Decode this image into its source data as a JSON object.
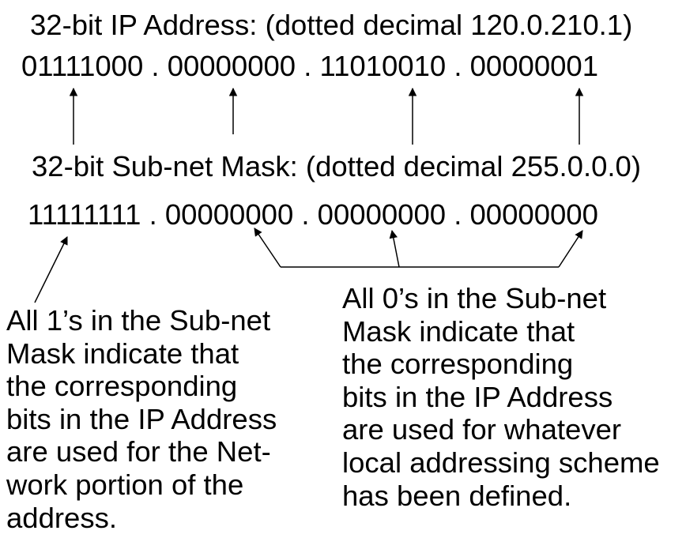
{
  "ip_address": {
    "title": "32-bit IP Address:  (dotted decimal 120.0.210.1)",
    "binary": "01111000 . 00000000 . 11010010 . 00000001"
  },
  "subnet_mask": {
    "title": "32-bit Sub-net Mask: (dotted decimal 255.0.0.0)",
    "binary": "11111111 .  00000000 .  00000000 .  00000000"
  },
  "notes": {
    "ones": [
      "All 1’s in the Sub-net",
      "Mask indicate that",
      "the corresponding",
      "bits in the IP Address",
      "are used for the Net-",
      "work portion of the",
      "address."
    ],
    "zeros": [
      "All 0’s in the Sub-net",
      "Mask indicate that",
      "the corresponding",
      "bits in the IP Address",
      "are used for whatever",
      "local addressing scheme",
      "has been defined."
    ]
  }
}
